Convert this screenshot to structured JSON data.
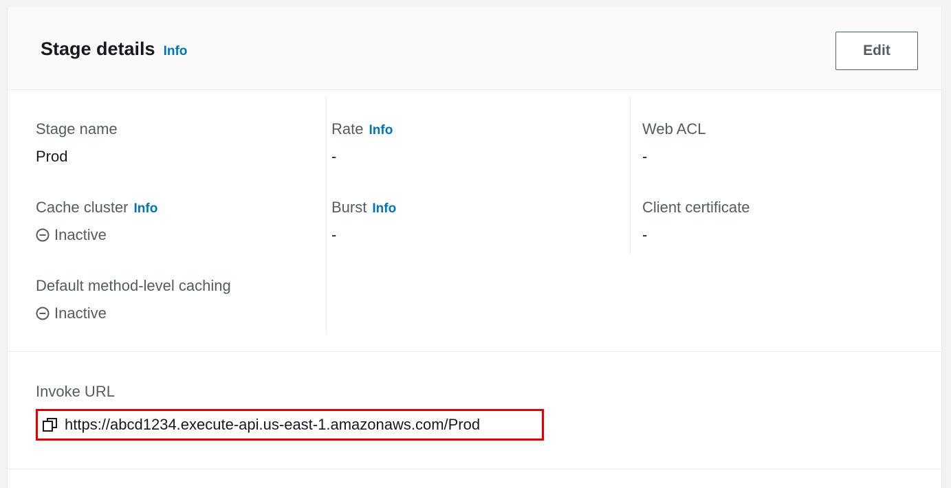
{
  "header": {
    "title": "Stage details",
    "info_label": "Info",
    "edit_label": "Edit"
  },
  "columns": {
    "col1": [
      {
        "label": "Stage name",
        "value": "Prod"
      },
      {
        "label": "Cache cluster",
        "info": "Info",
        "value": "Inactive",
        "status_icon": "minus-circle-icon"
      },
      {
        "label": "Default method-level caching",
        "value": "Inactive",
        "status_icon": "minus-circle-icon"
      }
    ],
    "col2": [
      {
        "label": "Rate",
        "info": "Info",
        "value": "-"
      },
      {
        "label": "Burst",
        "info": "Info",
        "value": "-"
      }
    ],
    "col3": [
      {
        "label": "Web ACL",
        "value": "-"
      },
      {
        "label": "Client certificate",
        "value": "-"
      }
    ]
  },
  "invoke": {
    "label": "Invoke URL",
    "url": "https://abcd1234.execute-api.us-east-1.amazonaws.com/Prod",
    "copy_icon": "copy-icon",
    "highlight_color": "#e00000"
  },
  "colors": {
    "link": "#0073bb",
    "text": "#16191f",
    "secondary_text": "#545b64"
  }
}
